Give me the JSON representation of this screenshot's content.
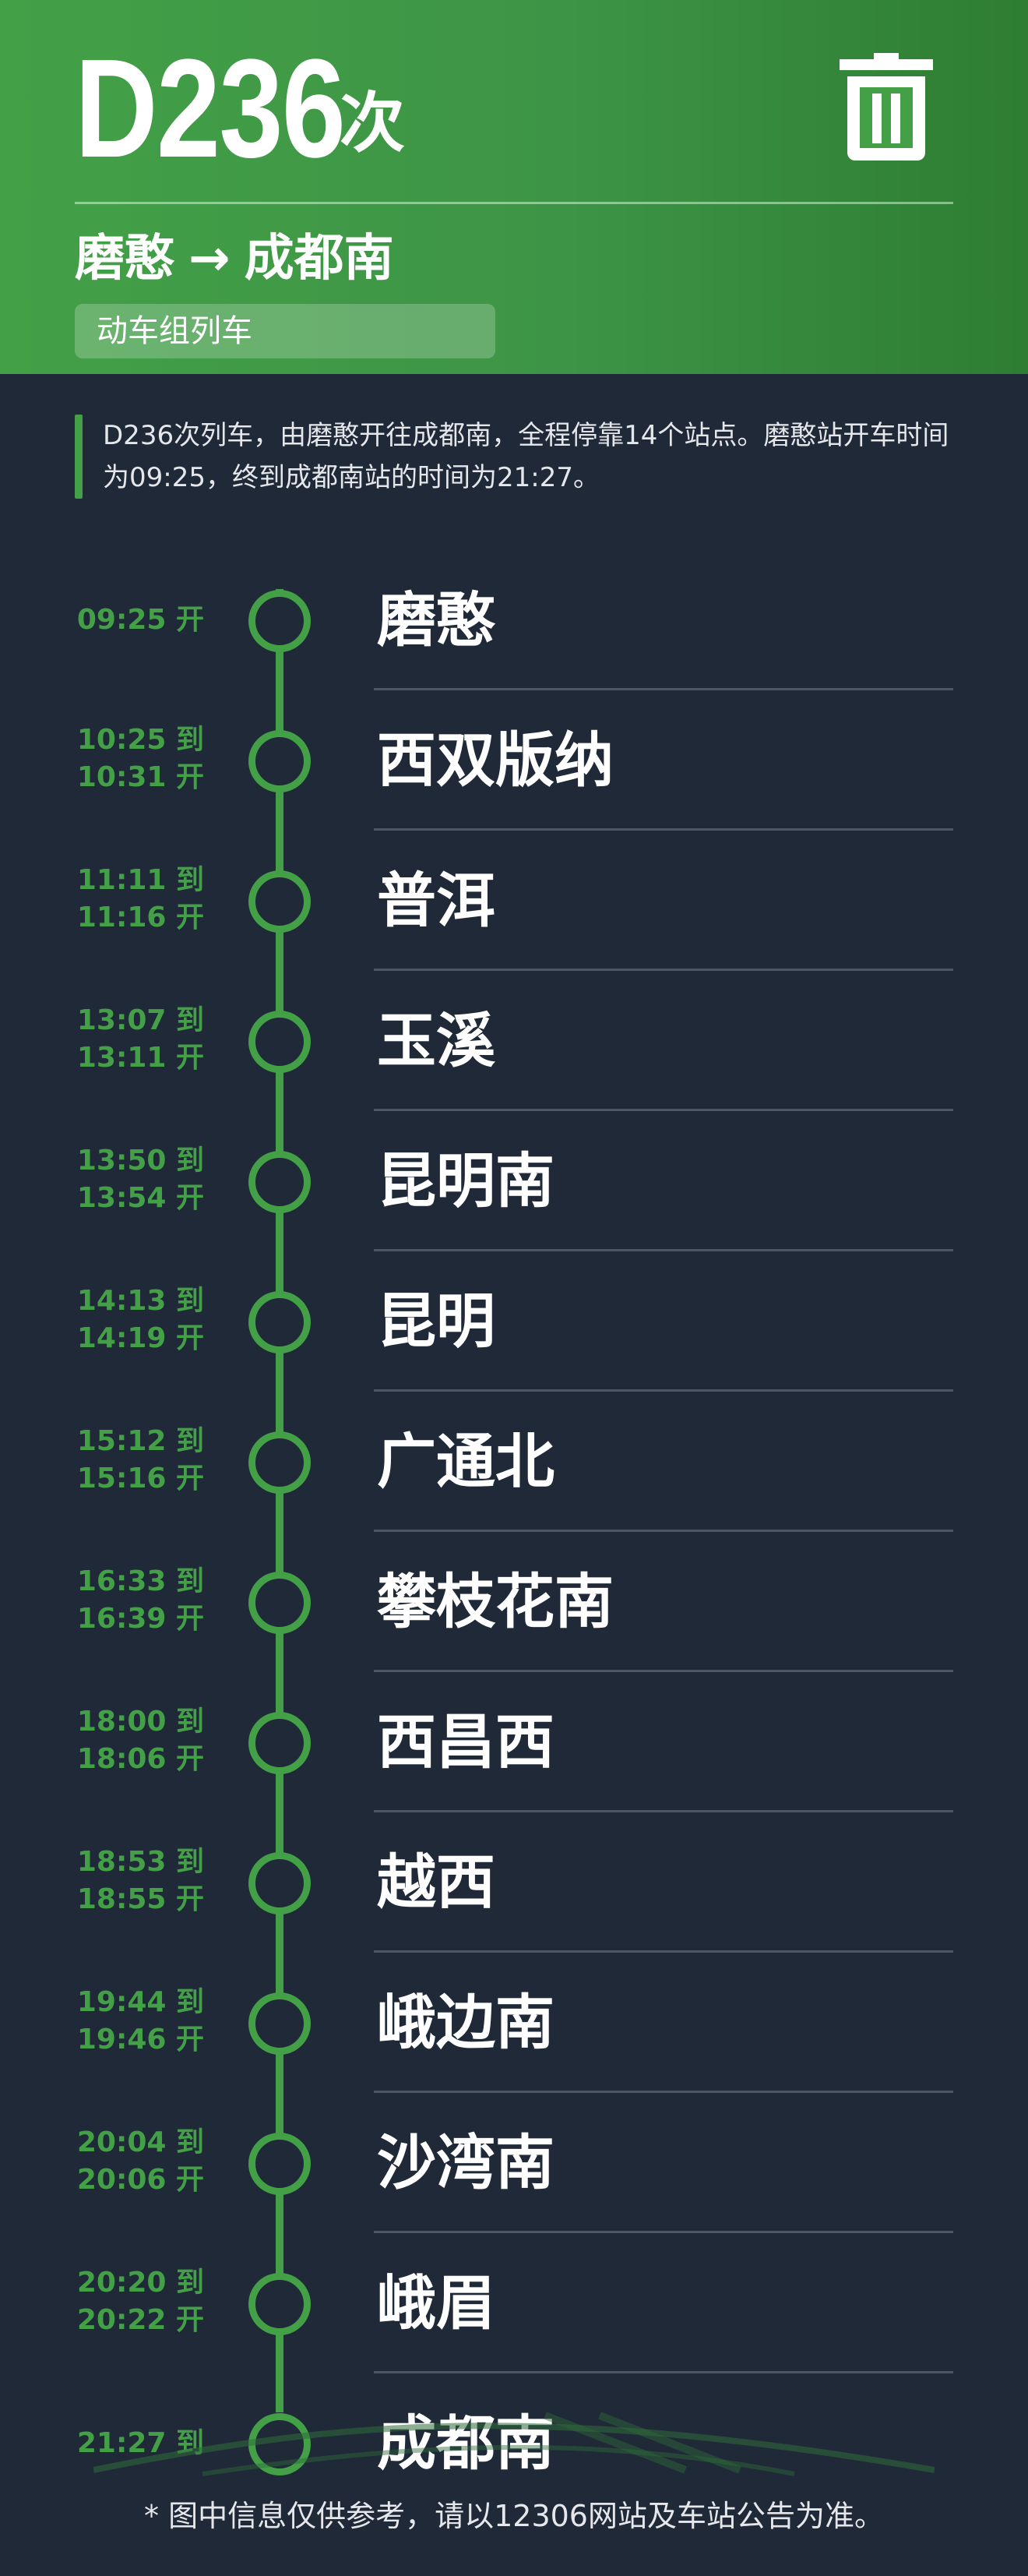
{
  "header": {
    "train_number": "D236",
    "train_suffix": "次",
    "from": "磨憨",
    "arrow": "→",
    "to": "成都南",
    "train_type": "动车组列车",
    "delete_icon": "trash-icon"
  },
  "summary": "D236次列车，由磨憨开往成都南，全程停靠14个站点。磨憨站开车时间为09:25，终到成都南站的时间为21:27。",
  "stops": [
    {
      "name": "磨憨",
      "line1": "",
      "line2": "09:25 开"
    },
    {
      "name": "西双版纳",
      "line1": "10:25 到",
      "line2": "10:31 开"
    },
    {
      "name": "普洱",
      "line1": "11:11 到",
      "line2": "11:16 开"
    },
    {
      "name": "玉溪",
      "line1": "13:07 到",
      "line2": "13:11 开"
    },
    {
      "name": "昆明南",
      "line1": "13:50 到",
      "line2": "13:54 开"
    },
    {
      "name": "昆明",
      "line1": "14:13 到",
      "line2": "14:19 开"
    },
    {
      "name": "广通北",
      "line1": "15:12 到",
      "line2": "15:16 开"
    },
    {
      "name": "攀枝花南",
      "line1": "16:33 到",
      "line2": "16:39 开"
    },
    {
      "name": "西昌西",
      "line1": "18:00 到",
      "line2": "18:06 开"
    },
    {
      "name": "越西",
      "line1": "18:53 到",
      "line2": "18:55 开"
    },
    {
      "name": "峨边南",
      "line1": "19:44 到",
      "line2": "19:46 开"
    },
    {
      "name": "沙湾南",
      "line1": "20:04 到",
      "line2": "20:06 开"
    },
    {
      "name": "峨眉",
      "line1": "20:20 到",
      "line2": "20:22 开"
    },
    {
      "name": "成都南",
      "line1": "",
      "line2": "21:27 到"
    }
  ],
  "footnote": "* 图中信息仅供参考，请以12306网站及车站公告为准。",
  "colors": {
    "accent": "#43a047",
    "background": "#1f2937",
    "text": "#ffffff"
  }
}
